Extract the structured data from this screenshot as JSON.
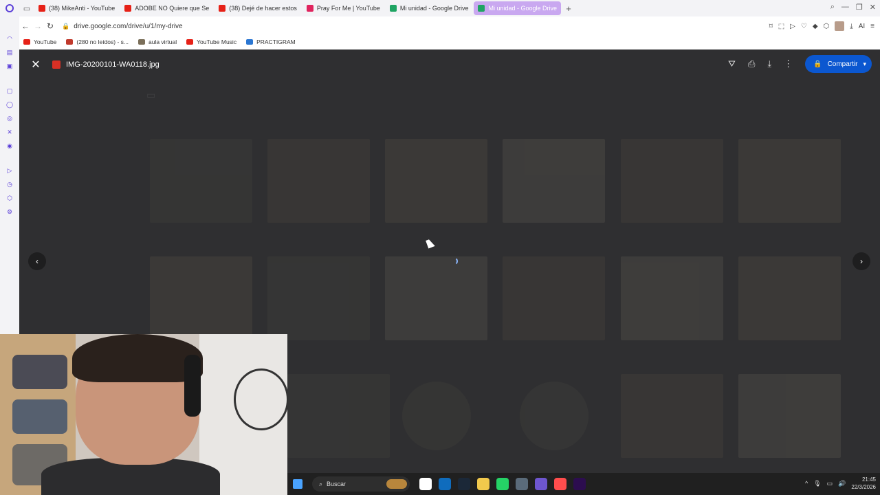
{
  "browser": {
    "tabs": [
      {
        "label": "(38) MikeAnti - YouTube",
        "color": "#e62117",
        "active": false
      },
      {
        "label": "ADOBE NO Quiere que Se",
        "color": "#e62117",
        "active": false
      },
      {
        "label": "(38) Dejé de hacer estos",
        "color": "#e62117",
        "active": false
      },
      {
        "label": "Pray For Me | YouTube",
        "color": "#e0245e",
        "active": false
      },
      {
        "label": "Mi unidad - Google Drive",
        "color": "#1fa463",
        "active": false
      },
      {
        "label": "Mi unidad - Google Drive",
        "color": "#1fa463",
        "active": true
      }
    ],
    "new_tab": "+",
    "url": "drive.google.com/drive/u/1/my-drive",
    "ai_label": "AI",
    "bookmarks": [
      {
        "label": "YouTube",
        "color": "#e62117"
      },
      {
        "label": "(280 no leídos) - s...",
        "color": "#c0392b"
      },
      {
        "label": "aula virtual",
        "color": "#7b6f5a"
      },
      {
        "label": "YouTube Music",
        "color": "#e62117"
      },
      {
        "label": "PRACTIGRAM",
        "color": "#2a76d2"
      }
    ]
  },
  "viewer": {
    "file_name": "IMG-20200101-WA0118.jpg",
    "share_label": "Compartir",
    "prev_icon": "‹",
    "next_icon": "›"
  },
  "taskbar": {
    "search_placeholder": "Buscar",
    "time": "21:45",
    "date": "22/3/2026",
    "apps": [
      "#ffffff",
      "#0f6cbd",
      "#1b2838",
      "#f2c94c",
      "#25d366",
      "#5a6b7a",
      "#6e56cf",
      "#ff4d4d",
      "#2c0d4f"
    ]
  }
}
